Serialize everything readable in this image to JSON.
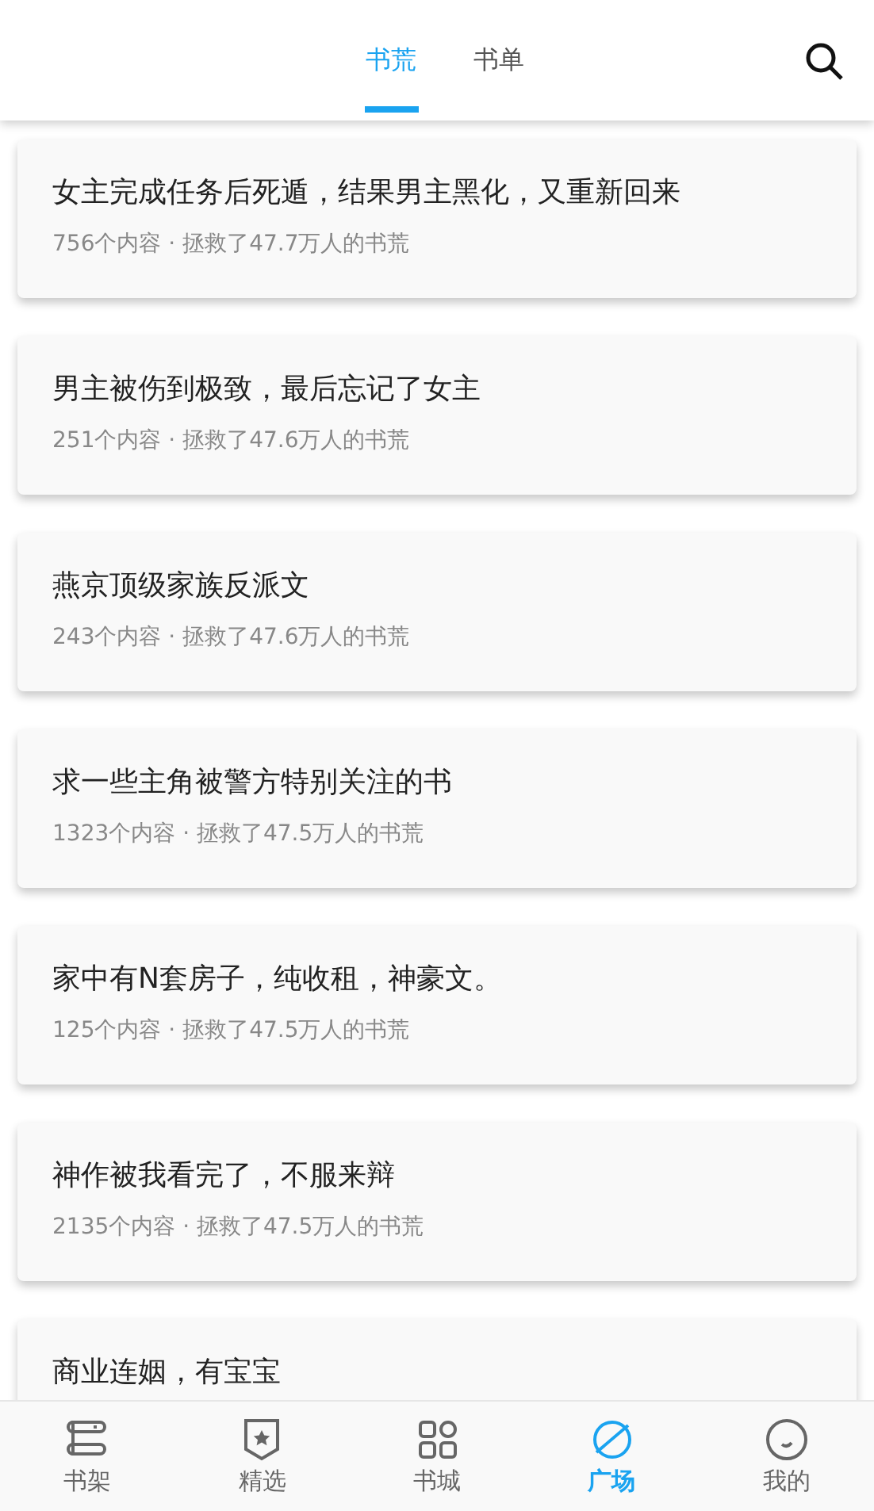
{
  "tabs": [
    {
      "label": "书荒",
      "selected": true
    },
    {
      "label": "书单",
      "selected": false
    }
  ],
  "cards": [
    {
      "title": "女主完成任务后死遁，结果男主黑化，又重新回来",
      "meta": "756个内容 · 拯救了47.7万人的书荒"
    },
    {
      "title": "男主被伤到极致，最后忘记了女主",
      "meta": "251个内容 · 拯救了47.6万人的书荒"
    },
    {
      "title": "燕京顶级家族反派文",
      "meta": "243个内容 · 拯救了47.6万人的书荒"
    },
    {
      "title": "求一些主角被警方特别关注的书",
      "meta": "1323个内容 · 拯救了47.5万人的书荒"
    },
    {
      "title": "家中有N套房子，纯收租，神豪文。",
      "meta": "125个内容 · 拯救了47.5万人的书荒"
    },
    {
      "title": "神作被我看完了，不服来辩",
      "meta": "2135个内容 · 拯救了47.5万人的书荒"
    },
    {
      "title": "商业连姻，有宝宝"
    }
  ],
  "nav": [
    {
      "label": "书架",
      "kind": "shelf",
      "selected": false
    },
    {
      "label": "精选",
      "kind": "featured",
      "selected": false
    },
    {
      "label": "书城",
      "kind": "store",
      "selected": false
    },
    {
      "label": "广场",
      "kind": "square",
      "selected": true
    },
    {
      "label": "我的",
      "kind": "me",
      "selected": false
    }
  ]
}
